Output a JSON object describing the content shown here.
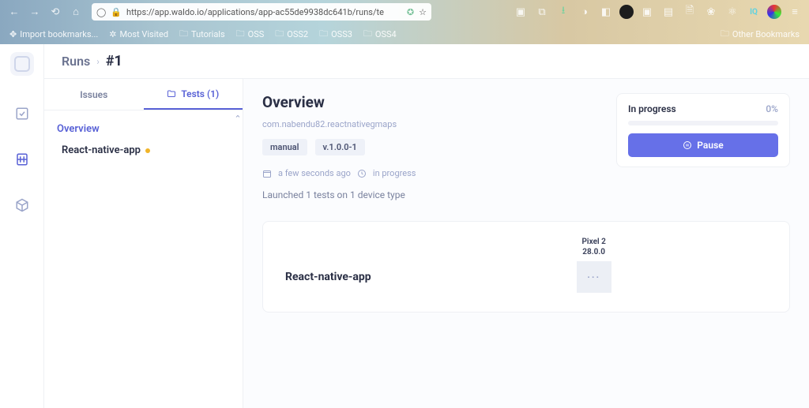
{
  "browser": {
    "url": "https://app.waldo.io/applications/app-ac55de9938dc641b/runs/te",
    "bookmarks": [
      "Import bookmarks...",
      "Most Visited",
      "Tutorials",
      "OSS",
      "OSS2",
      "OSS3",
      "OSS4"
    ],
    "rightBookmark": "Other Bookmarks"
  },
  "breadcrumb": {
    "root": "Runs",
    "current": "#1"
  },
  "tabs": {
    "issues": "Issues",
    "tests": "Tests (1)"
  },
  "sidebar": {
    "overview": "Overview",
    "items": [
      {
        "label": "React-native-app"
      }
    ]
  },
  "overview": {
    "title": "Overview",
    "package": "com.nabendu82.reactnativegmaps",
    "tags": [
      "manual",
      "v.1.0.0-1"
    ],
    "time": "a few seconds ago",
    "status": "in progress",
    "launched": "Launched 1 tests on 1 device type"
  },
  "statusCard": {
    "label": "In progress",
    "percent": "0%",
    "pause": "Pause"
  },
  "testCard": {
    "name": "React-native-app",
    "device": "Pixel 2",
    "os": "28.0.0"
  }
}
